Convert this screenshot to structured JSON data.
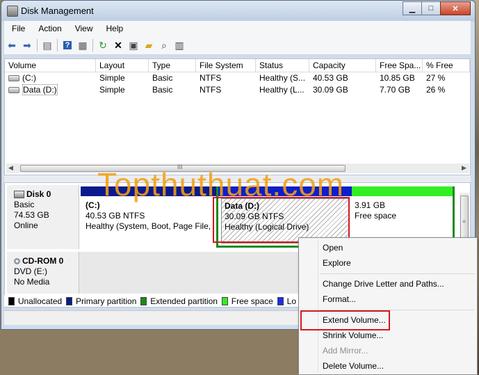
{
  "window": {
    "title": "Disk Management"
  },
  "menu": [
    "File",
    "Action",
    "View",
    "Help"
  ],
  "toolbar_icons": [
    "back-arrow-icon",
    "forward-arrow-icon",
    "console-tree-icon",
    "help-icon",
    "properties-icon",
    "refresh-icon",
    "delete-icon",
    "properties-sheet-icon",
    "open-folder-icon",
    "search-icon",
    "settings-icon"
  ],
  "volumes": {
    "columns": [
      "Volume",
      "Layout",
      "Type",
      "File System",
      "Status",
      "Capacity",
      "Free Spa...",
      "% Free"
    ],
    "rows": [
      [
        "(C:)",
        "Simple",
        "Basic",
        "NTFS",
        "Healthy (S...",
        "40.53 GB",
        "10.85 GB",
        "27 %"
      ],
      [
        "Data (D:)",
        "Simple",
        "Basic",
        "NTFS",
        "Healthy (L...",
        "30.09 GB",
        "7.70 GB",
        "26 %"
      ]
    ],
    "scroll_grip": "III"
  },
  "disk0": {
    "name": "Disk 0",
    "type": "Basic",
    "size": "74.53 GB",
    "state": "Online",
    "partitions": [
      {
        "label": "(C:)",
        "size": "40.53 GB NTFS",
        "status": "Healthy (System, Boot, Page File, A"
      },
      {
        "label": "Data  (D:)",
        "size": "30.09 GB NTFS",
        "status": "Healthy (Logical Drive)"
      },
      {
        "label": "",
        "size": "3.91 GB",
        "status": "Free space"
      }
    ]
  },
  "cdrom": {
    "name": "CD-ROM 0",
    "drive": "DVD (E:)",
    "media": "No Media"
  },
  "legend": [
    {
      "label": "Unallocated",
      "color": "#000000"
    },
    {
      "label": "Primary partition",
      "color": "#0a1a8c"
    },
    {
      "label": "Extended partition",
      "color": "#1a8a1a"
    },
    {
      "label": "Free space",
      "color": "#33ee22"
    },
    {
      "label": "Lo",
      "color": "#1a2ee8"
    }
  ],
  "watermark": "Topthuthuat.com",
  "context_menu": {
    "open": "Open",
    "explore": "Explore",
    "change_letter": "Change Drive Letter and Paths...",
    "format": "Format...",
    "extend": "Extend Volume...",
    "shrink": "Shrink Volume...",
    "add_mirror": "Add Mirror...",
    "delete": "Delete Volume..."
  },
  "colors": {
    "primary_bar": "#0a1a8c",
    "logical_bar": "#0d1fc8",
    "free_bar": "#33ee22",
    "extended_border": "#1a8a1a",
    "highlight_box": "#d11a20",
    "watermark": "#f4a012"
  }
}
